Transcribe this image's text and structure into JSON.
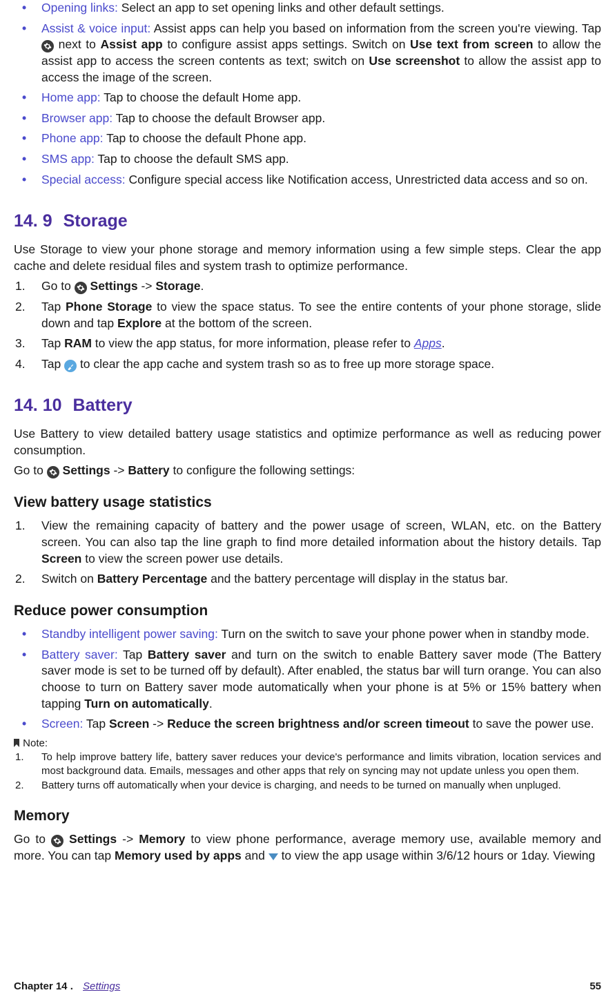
{
  "top_bullets": [
    {
      "term": "Opening links:",
      "text": " Select an app to set opening links and other default settings."
    },
    {
      "term": "Assist & voice input:",
      "text_pre": " Assist apps can help you based on information from the screen you're viewing. Tap ",
      "gear": true,
      "text_mid1": " next to ",
      "b1": "Assist app",
      "text_mid2": " to configure assist apps settings. Switch on ",
      "b2": "Use text from screen",
      "text_mid3": " to allow the assist app to access the screen contents as text; switch on ",
      "b3": "Use screenshot",
      "text_mid4": " to allow the assist app to access the image of the screen."
    },
    {
      "term": "Home app:",
      "text": " Tap to choose the default Home app."
    },
    {
      "term": "Browser app:",
      "text": " Tap to choose the default Browser app."
    },
    {
      "term": "Phone app:",
      "text": " Tap to choose the default Phone app."
    },
    {
      "term": "SMS app:",
      "text": " Tap to choose the default SMS app."
    },
    {
      "term": "Special access:",
      "text": " Configure special access like Notification access, Unrestricted data access and so on."
    }
  ],
  "storage": {
    "num": "14. 9",
    "title": "Storage",
    "intro": "Use Storage to view your phone storage and memory information using a few simple steps. Clear the app cache and delete residual files and system trash to optimize performance.",
    "steps": {
      "s1_a": "Go to ",
      "s1_b": " Settings",
      "s1_c": " -> ",
      "s1_d": "Storage",
      "s1_e": ".",
      "s2_a": "Tap ",
      "s2_b": "Phone Storage",
      "s2_c": " to view the space status. To see the entire contents of your phone storage, slide down and tap ",
      "s2_d": "Explore",
      "s2_e": " at the bottom of the screen.",
      "s3_a": "Tap ",
      "s3_b": "RAM",
      "s3_c": " to view the app status, for more information, please refer to ",
      "s3_link": "Apps",
      "s3_d": ".",
      "s4_a": "Tap ",
      "s4_b": " to clear the app cache and system trash so as to free up more storage space."
    }
  },
  "battery": {
    "num": "14. 10",
    "title": "Battery",
    "intro": "Use Battery to view detailed battery usage statistics and optimize performance as well as reducing power consumption.",
    "goto_a": "Go to ",
    "goto_b": " Settings",
    "goto_c": " -> ",
    "goto_d": "Battery",
    "goto_e": " to configure the following settings:",
    "sub1": "View battery usage statistics",
    "sub1_s1_a": "View the remaining capacity of battery and the power usage of screen, WLAN, etc. on the Battery screen. You can also tap the line graph to find more detailed information about the history details. Tap ",
    "sub1_s1_b": "Screen",
    "sub1_s1_c": " to view the screen power use details.",
    "sub1_s2_a": "Switch on ",
    "sub1_s2_b": "Battery Percentage",
    "sub1_s2_c": " and the battery percentage will display in the status bar.",
    "sub2": "Reduce power consumption",
    "rpc": [
      {
        "term": "Standby intelligent power saving:",
        "text": " Turn on the switch to save your phone power when in standby mode."
      },
      {
        "term": "Battery saver:",
        "a": " Tap ",
        "b1": "Battery saver",
        "b": " and turn on the switch to enable Battery saver mode (The Battery saver mode is set to be turned off by default). After enabled, the status bar will turn orange. You can also choose to turn on Battery saver mode automatically when your phone is at 5% or 15% battery when tapping ",
        "b2": "Turn on automatically",
        "c": "."
      },
      {
        "term": "Screen:",
        "a": " Tap ",
        "b1": "Screen",
        "b": " -> ",
        "b2": "Reduce the screen brightness and/or screen timeout",
        "c": " to save the power use."
      }
    ],
    "note_label": " Note:",
    "notes": [
      "To help improve battery life, battery saver reduces your device's performance and limits vibration, location services and most background data. Emails, messages and other apps that rely on syncing may not update unless you open them.",
      "Battery turns off automatically when your device is charging, and needs to be turned on manually when unpluged."
    ],
    "sub3": "Memory",
    "mem_a": "Go to ",
    "mem_b": " Settings",
    "mem_c": " -> ",
    "mem_d": "Memory",
    "mem_e": " to view phone performance, average memory use, available memory and more. You can tap ",
    "mem_f": "Memory used by apps",
    "mem_g": " and ",
    "mem_h": " to view the app usage within 3/6/12 hours or 1day. Viewing"
  },
  "footer": {
    "chapter": "Chapter 14 .",
    "link": "Settings",
    "page": "55"
  }
}
